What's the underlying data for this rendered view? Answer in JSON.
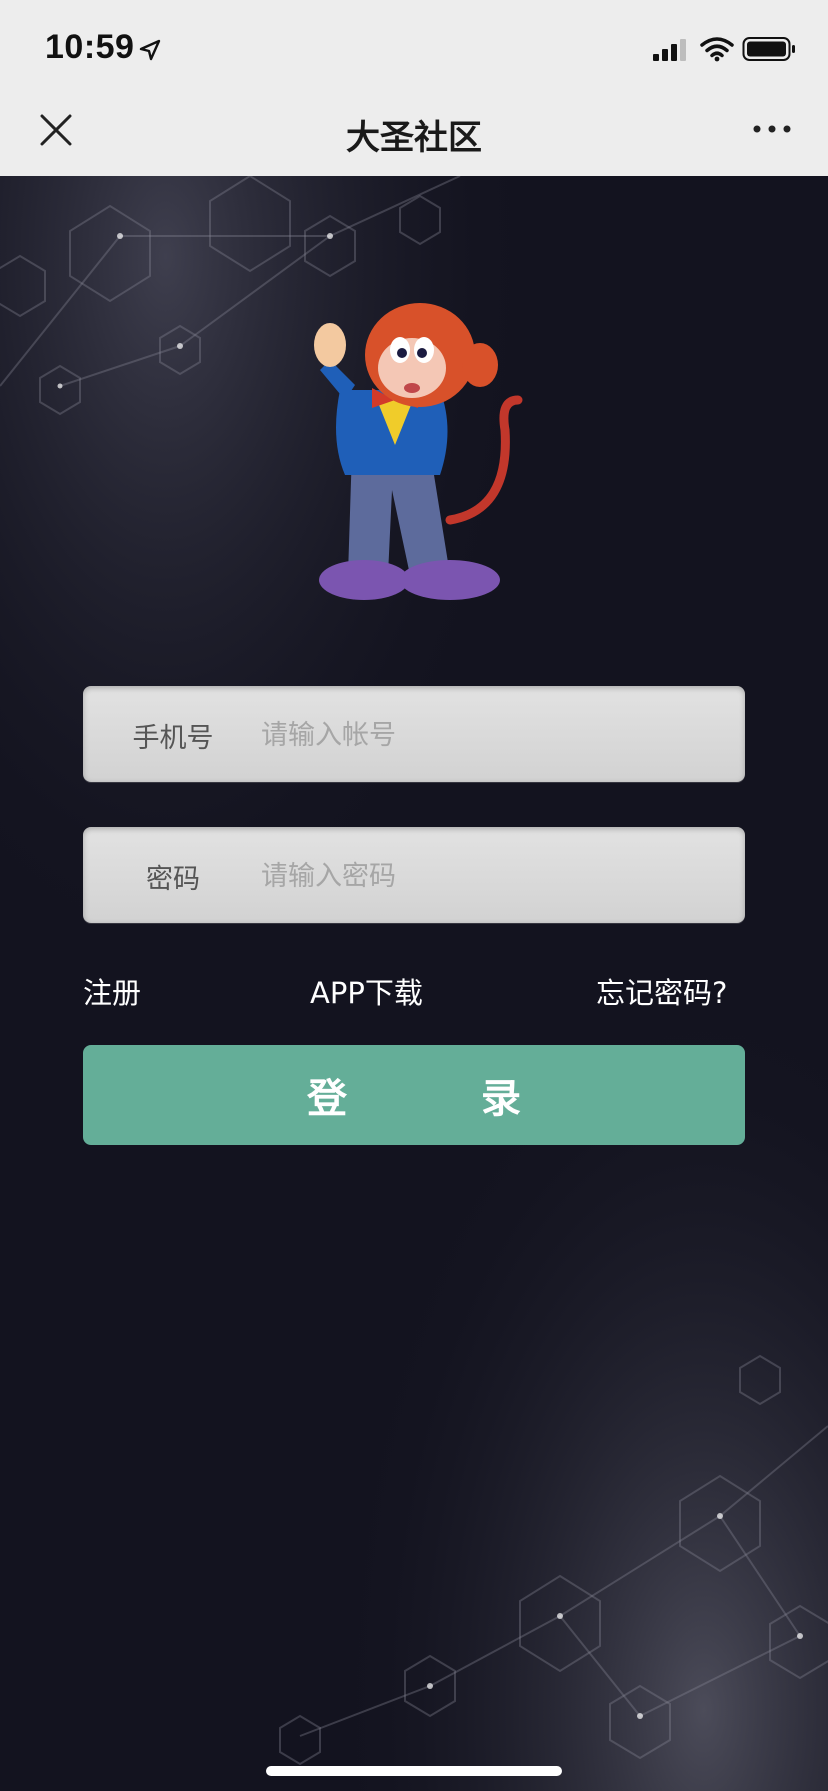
{
  "status_bar": {
    "time": "10:59"
  },
  "nav": {
    "title": "大圣社区"
  },
  "form": {
    "phone": {
      "label": "手机号",
      "placeholder": "请输入帐号",
      "value": ""
    },
    "password": {
      "label": "密码",
      "placeholder": "请输入密码",
      "value": ""
    }
  },
  "links": {
    "register": "注册",
    "app_download": "APP下载",
    "forgot_password": "忘记密码?"
  },
  "login_button": "登 录",
  "colors": {
    "accent": "#64ae98",
    "background": "#13131f",
    "header": "#ededed"
  },
  "icons": [
    "location-arrow-icon",
    "signal-icon",
    "wifi-icon",
    "battery-icon",
    "close-icon",
    "more-icon",
    "mascot-logo"
  ]
}
